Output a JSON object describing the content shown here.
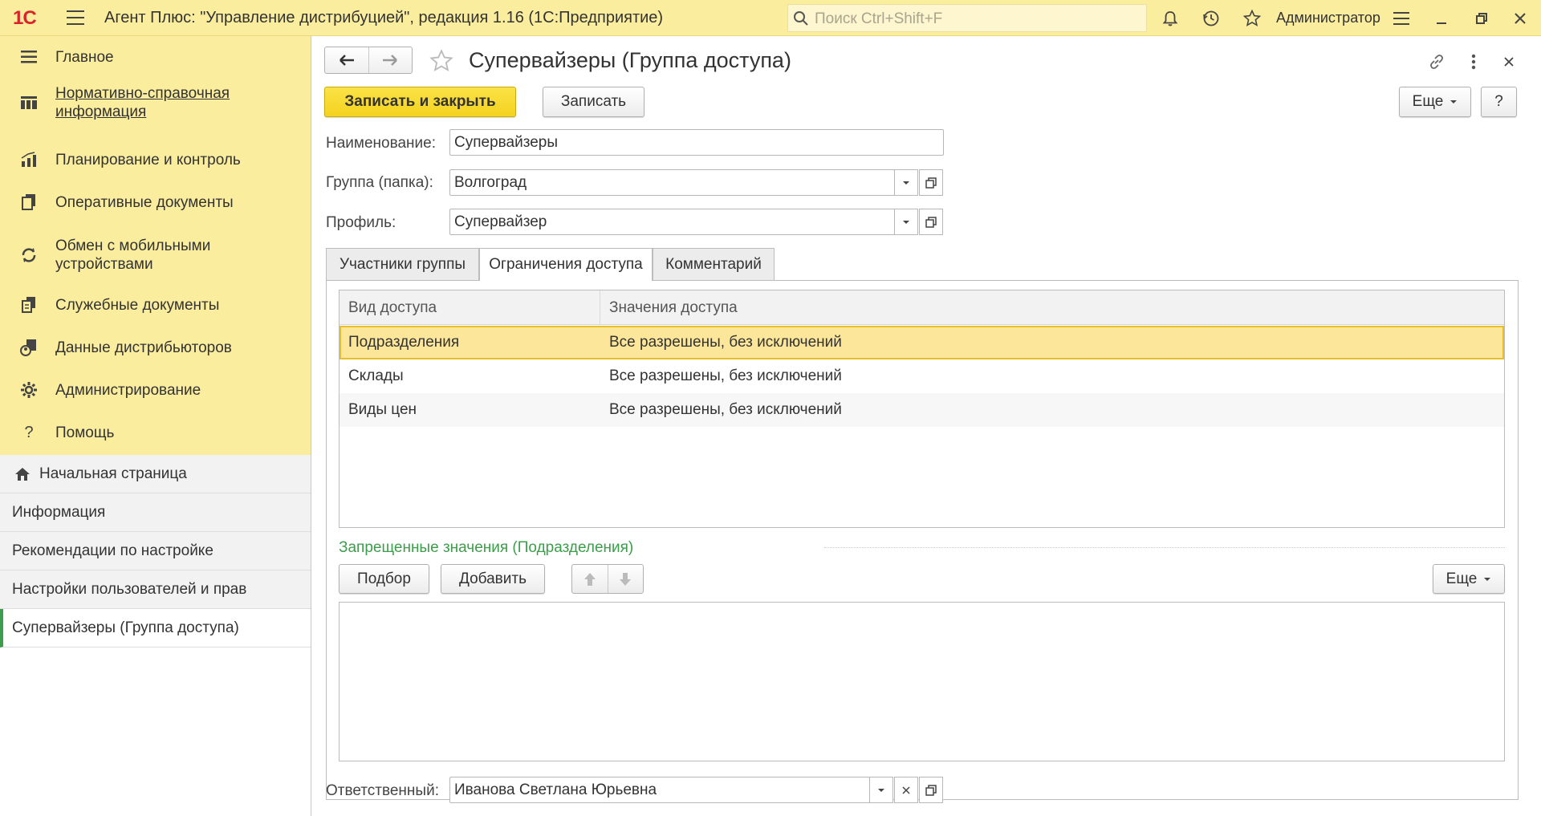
{
  "topbar": {
    "logo": "1С",
    "title": "Агент Плюс: \"Управление дистрибуцией\", редакция 1.16  (1С:Предприятие)",
    "search_placeholder": "Поиск Ctrl+Shift+F",
    "username": "Администратор",
    "icons": [
      "bell-icon",
      "history-icon",
      "star-icon",
      "settings-menu-icon",
      "minimize-icon",
      "restore-icon",
      "close-icon"
    ]
  },
  "sidebar": {
    "items": [
      {
        "label": "Главное",
        "icon": "hamburger-icon"
      },
      {
        "label": "Нормативно-справочная информация",
        "icon": "catalog-icon"
      },
      {
        "label": "Планирование и контроль",
        "icon": "chart-icon"
      },
      {
        "label": "Оперативные документы",
        "icon": "documents-icon"
      },
      {
        "label": "Обмен с мобильными устройствами",
        "icon": "sync-icon"
      },
      {
        "label": "Служебные документы",
        "icon": "service-docs-icon"
      },
      {
        "label": "Данные дистрибьюторов",
        "icon": "distributor-icon"
      },
      {
        "label": "Администрирование",
        "icon": "gear-icon"
      },
      {
        "label": "Помощь",
        "icon": "help-icon"
      }
    ],
    "open_windows": [
      {
        "label": "Начальная страница"
      },
      {
        "label": "Информация"
      },
      {
        "label": "Рекомендации по настройке"
      },
      {
        "label": "Настройки пользователей и прав"
      },
      {
        "label": "Супервайзеры (Группа доступа)"
      }
    ]
  },
  "form": {
    "title": "Супервайзеры (Группа доступа)",
    "toolbar": {
      "save_close": "Записать и закрыть",
      "save": "Записать",
      "more": "Еще",
      "help": "?"
    },
    "fields": {
      "name_label": "Наименование:",
      "name_value": "Супервайзеры",
      "group_label": "Группа (папка):",
      "group_value": "Волгоград",
      "profile_label": "Профиль:",
      "profile_value": "Супервайзер",
      "responsible_label": "Ответственный:",
      "responsible_value": "Иванова Светлана Юрьевна"
    },
    "tabs": [
      {
        "label": "Участники группы"
      },
      {
        "label": "Ограничения доступа"
      },
      {
        "label": "Комментарий"
      }
    ],
    "access_table": {
      "columns": [
        "Вид доступа",
        "Значения доступа"
      ],
      "rows": [
        {
          "kind": "Подразделения",
          "value": "Все разрешены, без исключений"
        },
        {
          "kind": "Склады",
          "value": "Все разрешены, без исключений"
        },
        {
          "kind": "Виды цен",
          "value": "Все разрешены, без исключений"
        }
      ]
    },
    "forbidden": {
      "title": "Запрещенные значения (Подразделения)",
      "pick": "Подбор",
      "add": "Добавить",
      "more": "Еще"
    }
  }
}
